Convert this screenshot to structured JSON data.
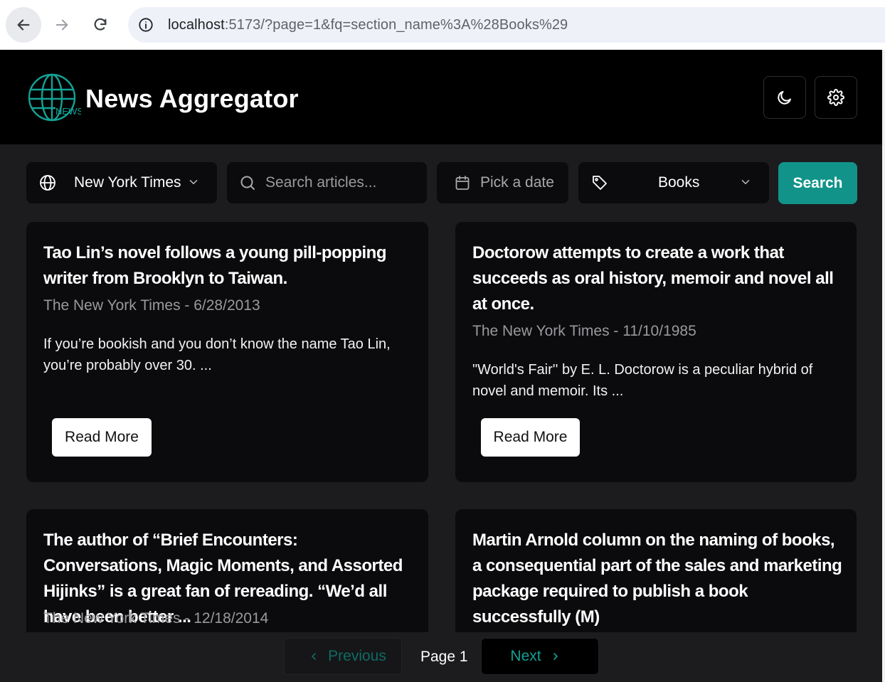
{
  "browser": {
    "url_host": "localhost",
    "url_rest": ":5173/?page=1&fq=section_name%3A%28Books%29"
  },
  "app": {
    "title": "News Aggregator",
    "logo_text": "NEWS",
    "accent_color": "#11938a"
  },
  "filters": {
    "source": "New York Times",
    "search_placeholder": "Search articles...",
    "date_placeholder": "Pick a date",
    "section": "Books",
    "search_button": "Search"
  },
  "articles": [
    {
      "title": "Tao Lin’s novel follows a young pill-popping writer from Brooklyn to Taiwan.",
      "meta": "The New York Times - 6/28/2013",
      "description": "If you’re bookish and you don’t know the name Tao Lin, you’re probably over 30. ...",
      "button": "Read More"
    },
    {
      "title": "Doctorow attempts to create a work that succeeds as oral history, memoir and novel all at once.",
      "meta": "The New York Times - 11/10/1985",
      "description": "\"World's Fair'' by E. L. Doctorow is a peculiar hybrid of novel and memoir. Its ...",
      "button": "Read More"
    },
    {
      "title": "The author of “Brief Encounters: Conversations, Magic Moments, and Assorted Hijinks” is a great fan of rereading. “We’d all have been better ...",
      "meta": "The New York Times - 12/18/2014"
    },
    {
      "title": "Martin Arnold column on the naming of books, a consequential part of the sales and marketing package required to publish a book successfully (M)"
    }
  ],
  "pagination": {
    "previous": "Previous",
    "page_label": "Page 1",
    "next": "Next"
  }
}
